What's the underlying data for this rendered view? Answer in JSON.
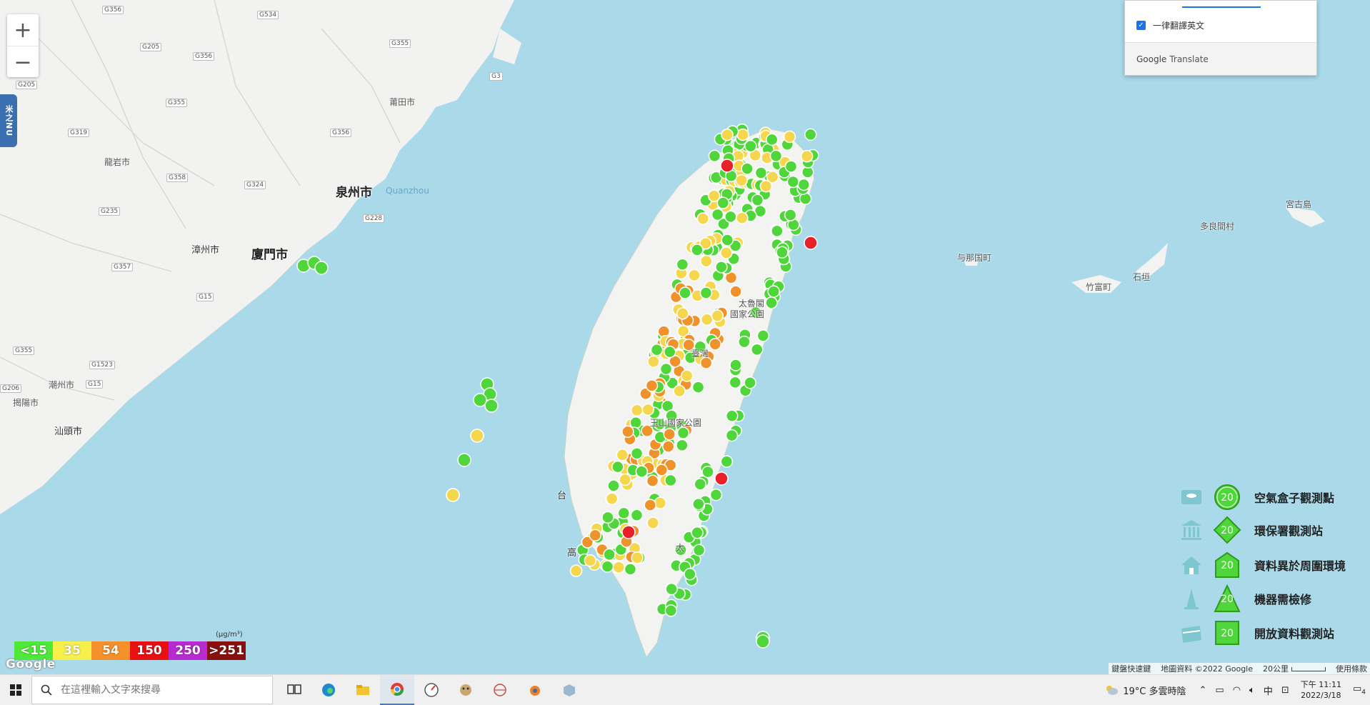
{
  "map": {
    "zoom_in_label": "+",
    "zoom_out_label": "−",
    "side_tab_label": "米之NU",
    "labels": {
      "putian": "莆田市",
      "longyan": "龍岩市",
      "quanzhou": "泉州市",
      "quanzhou_en": "Quanzhou",
      "zhangzhou": "漳州市",
      "xiamen": "廈門市",
      "chaozhou": "潮州市",
      "jieyang": "揭陽市",
      "shantou": "汕頭市",
      "yonaguni": "与那国町",
      "taketomi": "竹富町",
      "ishigaki": "石垣",
      "tarama": "多良間村",
      "miyakojima": "宮古島",
      "taroko": "太魯閣",
      "taroko2": "國家公園",
      "taiwan": "臺灣",
      "yushan": "玉山國家公園",
      "kaohsiung": "高",
      "taitung": "太",
      "tainan": "台"
    },
    "roads": [
      "G356",
      "G534",
      "G205",
      "G355",
      "G356",
      "G319",
      "G235",
      "G358",
      "G324",
      "G357",
      "G355",
      "G205",
      "G3",
      "G15",
      "G1523",
      "G206",
      "G355",
      "G15",
      "G228",
      "G356"
    ],
    "colors": {
      "green": "#4fd63a",
      "yellow": "#f5d64c",
      "orange": "#f0922b",
      "red": "#e8202a"
    }
  },
  "translate_popup": {
    "option_label": "一律翻譯英文",
    "footer_brand": "Google",
    "footer_product": "Translate"
  },
  "legend": [
    {
      "label": "空氣盒子觀測點",
      "value": "20",
      "icon": "cloud-box-icon"
    },
    {
      "label": "環保署觀測站",
      "value": "20",
      "icon": "government-building-icon"
    },
    {
      "label": "資料異於周圍環境",
      "value": "20",
      "icon": "house-icon"
    },
    {
      "label": "機器需檢修",
      "value": "20",
      "icon": "cone-icon"
    },
    {
      "label": "開放資料觀測站",
      "value": "20",
      "icon": "open-data-icon"
    }
  ],
  "scale": {
    "unit": "(μg/m³)",
    "items": [
      {
        "label": "<15",
        "color": "#4fe83a"
      },
      {
        "label": "35",
        "color": "#f8f04a"
      },
      {
        "label": "54",
        "color": "#f5902b"
      },
      {
        "label": "150",
        "color": "#e81010"
      },
      {
        "label": "250",
        "color": "#b82bd0"
      },
      {
        "label": ">251",
        "color": "#8a1010"
      }
    ]
  },
  "attribution": {
    "google": "Google",
    "shortcuts": "鍵盤快速鍵",
    "map_data": "地圖資料 ©2022 Google",
    "scale": "20公里",
    "terms": "使用條款"
  },
  "taskbar": {
    "search_placeholder": "在這裡輸入文字來搜尋",
    "weather": "19°C 多雲時陰",
    "ime": "中",
    "time": "下午 11:11",
    "date": "2022/3/18",
    "notifications": "4",
    "apps": [
      "task-view-icon",
      "edge-icon",
      "file-explorer-icon",
      "chrome-icon",
      "compass-app-icon",
      "game-app-icon",
      "network-app-icon",
      "blender-icon",
      "package-icon"
    ]
  }
}
